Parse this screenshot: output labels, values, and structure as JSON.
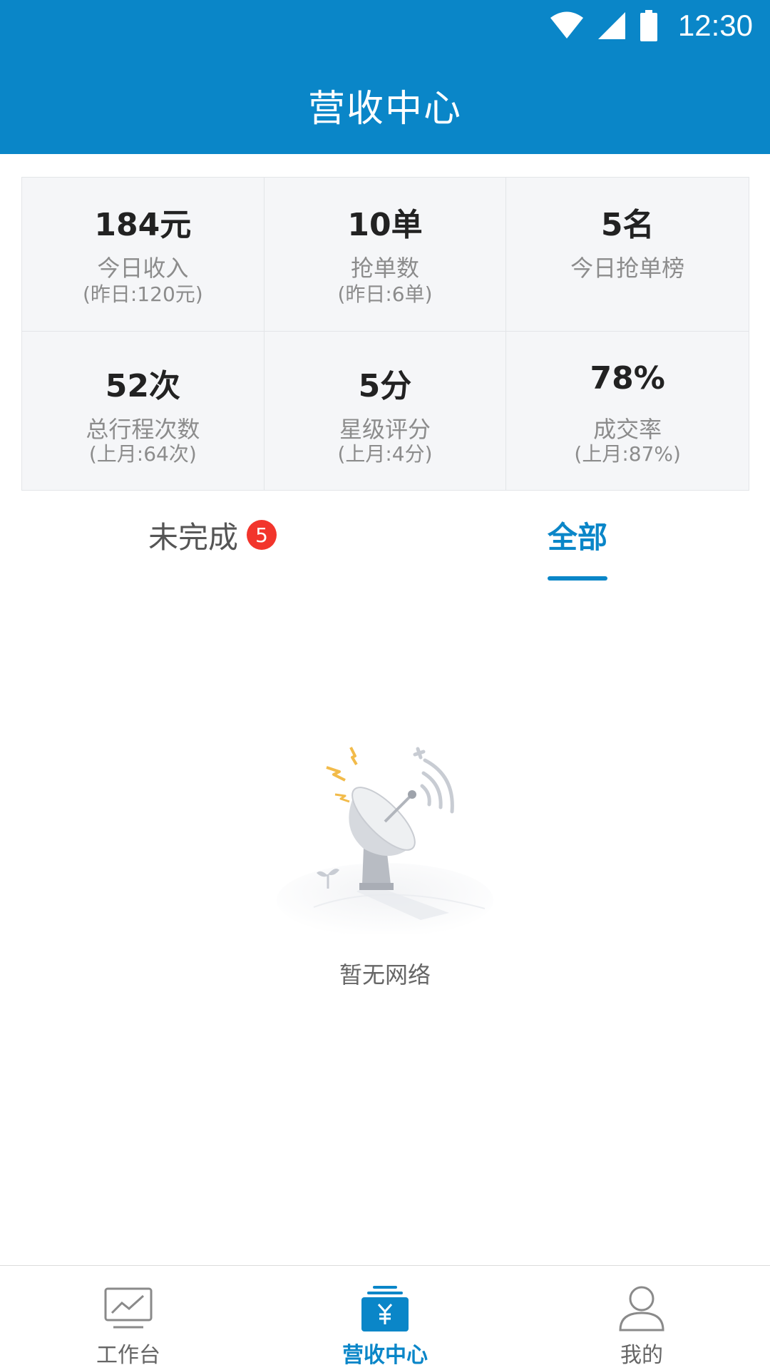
{
  "status_bar": {
    "time": "12:30",
    "icons": [
      "wifi-icon",
      "signal-icon",
      "battery-icon"
    ]
  },
  "header": {
    "title": "营收中心"
  },
  "stats": [
    {
      "value": "184元",
      "label": "今日收入",
      "sub": "(昨日:120元)"
    },
    {
      "value": "10单",
      "label": "抢单数",
      "sub": "(昨日:6单)"
    },
    {
      "value": "5名",
      "label": "今日抢单榜",
      "sub": ""
    },
    {
      "value": "52次",
      "label": "总行程次数",
      "sub": "(上月:64次)"
    },
    {
      "value": "5分",
      "label": "星级评分",
      "sub": "(上月:4分)"
    },
    {
      "value": "78%",
      "label": "成交率",
      "sub": "(上月:87%)"
    }
  ],
  "tabs": [
    {
      "label": "未完成",
      "badge": "5"
    },
    {
      "label": "全部"
    }
  ],
  "empty_state": {
    "text": "暂无网络",
    "icon": "satellite-dish-icon"
  },
  "bottom_nav": [
    {
      "label": "工作台",
      "icon": "dashboard-chart-icon"
    },
    {
      "label": "营收中心",
      "icon": "yuan-wallet-icon"
    },
    {
      "label": "我的",
      "icon": "user-profile-icon"
    }
  ],
  "colors": {
    "primary": "#0a86c8",
    "badge": "#f2352c",
    "grid_bg": "#f5f6f8"
  }
}
